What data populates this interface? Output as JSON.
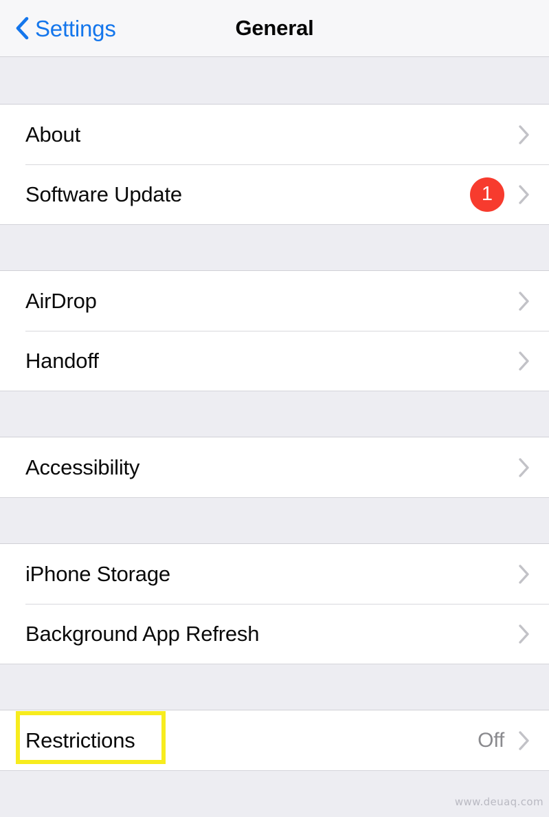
{
  "navbar": {
    "back_label": "Settings",
    "back_icon": "chevron-left-icon",
    "title": "General"
  },
  "sections": [
    {
      "rows": [
        {
          "label": "About",
          "value": "",
          "badge": "",
          "accessory": "chevron-right-icon"
        },
        {
          "label": "Software Update",
          "value": "",
          "badge": "1",
          "accessory": "chevron-right-icon"
        }
      ]
    },
    {
      "rows": [
        {
          "label": "AirDrop",
          "value": "",
          "badge": "",
          "accessory": "chevron-right-icon"
        },
        {
          "label": "Handoff",
          "value": "",
          "badge": "",
          "accessory": "chevron-right-icon"
        }
      ]
    },
    {
      "rows": [
        {
          "label": "Accessibility",
          "value": "",
          "badge": "",
          "accessory": "chevron-right-icon"
        }
      ]
    },
    {
      "rows": [
        {
          "label": "iPhone Storage",
          "value": "",
          "badge": "",
          "accessory": "chevron-right-icon"
        },
        {
          "label": "Background App Refresh",
          "value": "",
          "badge": "",
          "accessory": "chevron-right-icon"
        }
      ]
    },
    {
      "rows": [
        {
          "label": "Restrictions",
          "value": "Off",
          "badge": "",
          "accessory": "chevron-right-icon"
        }
      ]
    }
  ],
  "annotation": {
    "target": "Restrictions",
    "color": "#F7EC1E"
  },
  "watermark": {
    "text": "www.deuaq.com"
  },
  "colors": {
    "accent_blue": "#1476EC",
    "badge_red": "#F73B2E",
    "group_background": "#FFFFFF",
    "page_background": "#EDEDF2",
    "separator": "#D8D8DC",
    "value_gray": "#8A8A8E",
    "chevron_gray": "#C2C2C7"
  }
}
